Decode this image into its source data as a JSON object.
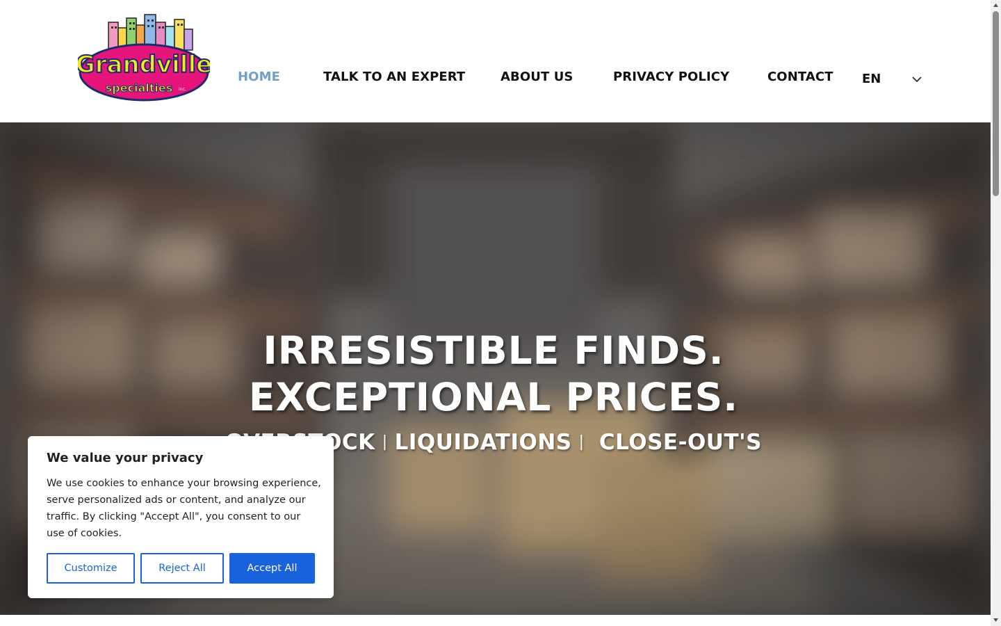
{
  "brand": {
    "name": "Grandville",
    "sub": "specialties",
    "suffix": "inc."
  },
  "nav": {
    "items": [
      {
        "label": "HOME",
        "active": true
      },
      {
        "label": "TALK TO AN EXPERT",
        "active": false
      },
      {
        "label": "ABOUT US",
        "active": false
      },
      {
        "label": "PRIVACY POLICY",
        "active": false
      },
      {
        "label": "CONTACT",
        "active": false
      }
    ],
    "language": "EN"
  },
  "hero": {
    "headline_line1": "IRRESISTIBLE FINDS.",
    "headline_line2": "EXCEPTIONAL PRICES.",
    "tagline_items": [
      "OVERSTOCK",
      "LIQUIDATIONS",
      "CLOSE-OUT'S"
    ],
    "separator": "|"
  },
  "cookie": {
    "title": "We value your privacy",
    "body": "We use cookies to enhance your browsing experience, serve personalized ads or content, and analyze our traffic. By clicking \"Accept All\", you consent to our use of cookies.",
    "customize_label": "Customize",
    "reject_label": "Reject All",
    "accept_label": "Accept All"
  },
  "colors": {
    "accent": "#1863dc",
    "nav_active": "#6f9fcb",
    "logo_magenta": "#e6157b",
    "logo_yellow": "#f5e62a"
  },
  "icons": {
    "language_toggle": "chevron-down-icon",
    "scroll_up": "triangle-up-icon",
    "scroll_down": "triangle-down-icon"
  }
}
